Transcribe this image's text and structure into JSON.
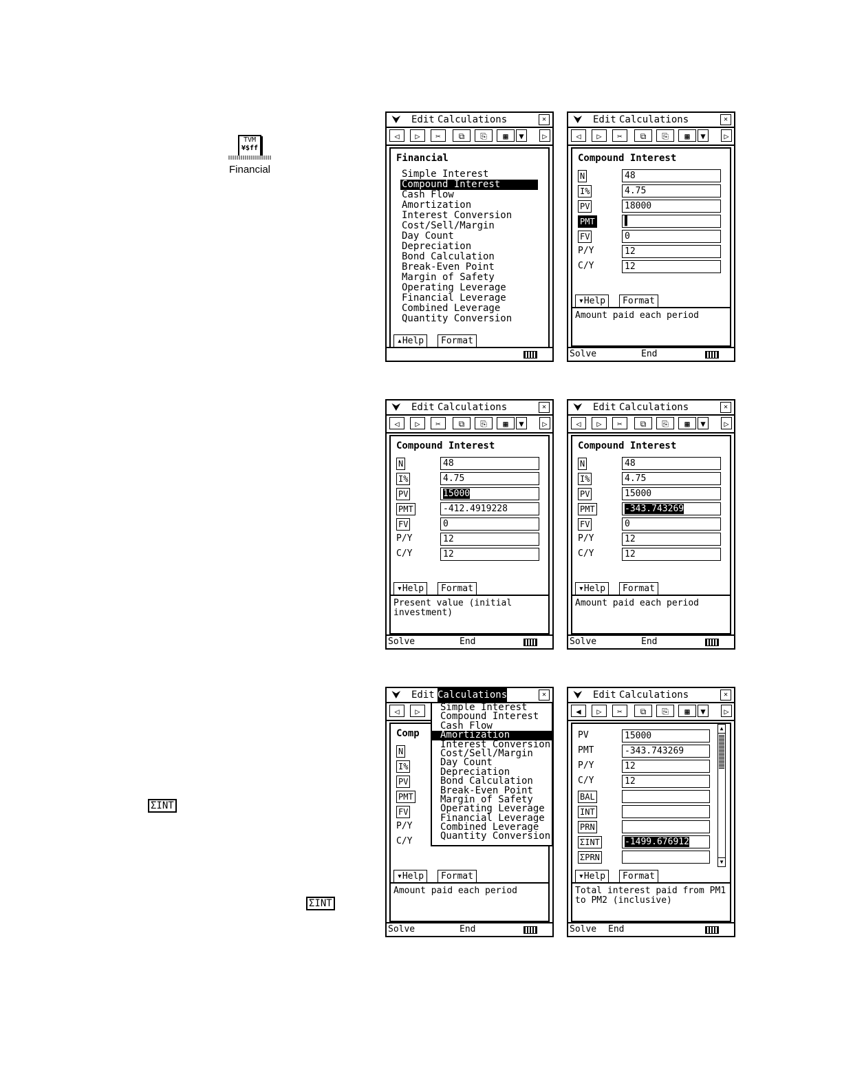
{
  "app_icon": {
    "line1": "TVM",
    "line2": "¥$ff",
    "label": "Financial"
  },
  "key_buttons": {
    "sum_int_1": "ΣINT",
    "sum_int_2": "ΣINT"
  },
  "common": {
    "menu_edit": "Edit",
    "menu_calc": "Calculations",
    "tab_help": "▾Help",
    "tab_help_up": "▴Help",
    "tab_format": "Format",
    "solve": "Solve",
    "end": "End"
  },
  "screen1": {
    "title": "Financial",
    "items": [
      "Simple Interest",
      "Compound Interest",
      "Cash Flow",
      "Amortization",
      "Interest Conversion",
      "Cost/Sell/Margin",
      "Day Count",
      "Depreciation",
      "Bond Calculation",
      "Break-Even Point",
      "Margin of Safety",
      "Operating Leverage",
      "Financial Leverage",
      "Combined Leverage",
      "Quantity Conversion"
    ],
    "selected": 1
  },
  "screen2": {
    "title": "Compound Interest",
    "fields": [
      {
        "label": "N",
        "value": "48"
      },
      {
        "label": "I%",
        "value": "4.75"
      },
      {
        "label": "PV",
        "value": "18000"
      },
      {
        "label": "PMT",
        "value": "▌"
      },
      {
        "label": "FV",
        "value": "0"
      },
      {
        "label": "P/Y",
        "value": "12"
      },
      {
        "label": "C/Y",
        "value": "12"
      }
    ],
    "help": "Amount paid each period"
  },
  "screen3": {
    "title": "Compound Interest",
    "fields": [
      {
        "label": "N",
        "value": "48"
      },
      {
        "label": "I%",
        "value": "4.75"
      },
      {
        "label": "PV",
        "value": "15000"
      },
      {
        "label": "PMT",
        "value": "-412.4919228"
      },
      {
        "label": "FV",
        "value": "0"
      },
      {
        "label": "P/Y",
        "value": "12"
      },
      {
        "label": "C/Y",
        "value": "12"
      }
    ],
    "help": "Present value (initial investment)"
  },
  "screen4": {
    "title": "Compound Interest",
    "fields": [
      {
        "label": "N",
        "value": "48"
      },
      {
        "label": "I%",
        "value": "4.75"
      },
      {
        "label": "PV",
        "value": "15000"
      },
      {
        "label": "PMT",
        "value": "-343.743269"
      },
      {
        "label": "FV",
        "value": "0"
      },
      {
        "label": "P/Y",
        "value": "12"
      },
      {
        "label": "C/Y",
        "value": "12"
      }
    ],
    "help": "Amount paid each period"
  },
  "screen5": {
    "title_partial": "Comp",
    "field_labels": [
      "N",
      "I%",
      "PV",
      "PMT",
      "FV",
      "P/Y",
      "C/Y"
    ],
    "dropdown_items": [
      "Simple Interest",
      "Compound Interest",
      "Cash Flow",
      "Amortization",
      "Interest Conversion",
      "Cost/Sell/Margin",
      "Day Count",
      "Depreciation",
      "Bond Calculation",
      "Break-Even Point",
      "Margin of Safety",
      "Operating Leverage",
      "Financial Leverage",
      "Combined Leverage",
      "Quantity Conversion"
    ],
    "dropdown_selected": 3,
    "help": "Amount paid each period"
  },
  "screen6": {
    "fields": [
      {
        "label": "PV",
        "value": "15000"
      },
      {
        "label": "PMT",
        "value": "-343.743269"
      },
      {
        "label": "P/Y",
        "value": "12"
      },
      {
        "label": "C/Y",
        "value": "12"
      },
      {
        "label": "BAL",
        "value": ""
      },
      {
        "label": "INT",
        "value": ""
      },
      {
        "label": "PRN",
        "value": ""
      },
      {
        "label": "ΣINT",
        "value": "-1499.676912"
      },
      {
        "label": "ΣPRN",
        "value": ""
      }
    ],
    "help": "Total interest paid from PM1 to PM2 (inclusive)"
  }
}
